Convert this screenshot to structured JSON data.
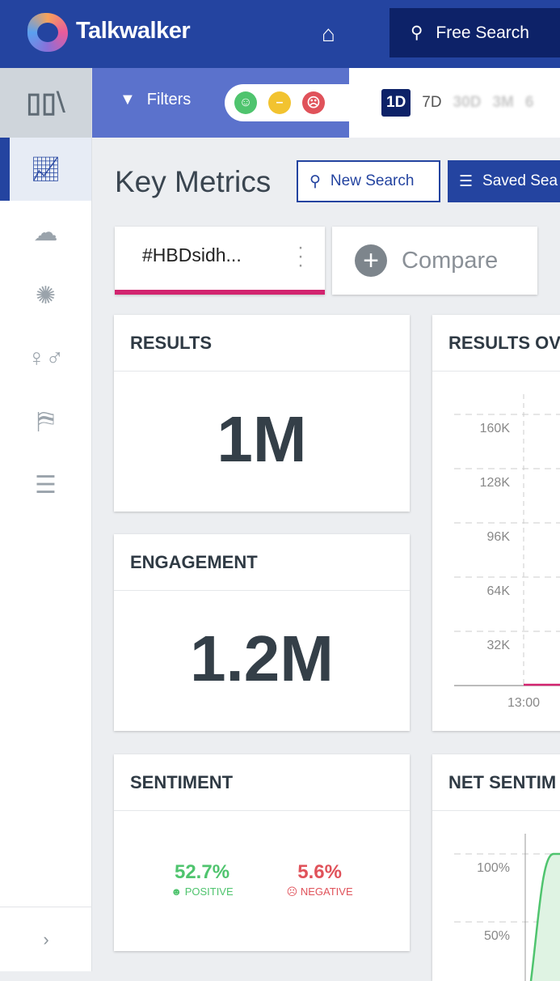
{
  "header": {
    "brand": "Talkwalker",
    "free_search": "Free Search"
  },
  "filterbar": {
    "filters": "Filters",
    "ranges": [
      "1D",
      "7D",
      "30D",
      "3M",
      "6"
    ],
    "selected_range": "1D"
  },
  "page": {
    "title": "Key Metrics",
    "new_search": "New Search",
    "saved_searches": "Saved Sea"
  },
  "tabs": {
    "active": "#HBDsidh...",
    "compare": "Compare"
  },
  "cards": {
    "results": {
      "title": "RESULTS",
      "value": "1M"
    },
    "engagement": {
      "title": "ENGAGEMENT",
      "value": "1.2M"
    },
    "sentiment": {
      "title": "SENTIMENT",
      "positive_value": "52.7%",
      "positive_label": "POSITIVE",
      "negative_value": "5.6%",
      "negative_label": "NEGATIVE"
    },
    "results_over_time": {
      "title": "RESULTS OV"
    },
    "net_sentiment": {
      "title": "NET SENTIM"
    }
  },
  "colors": {
    "header": "#2444a0",
    "accent_pink": "#d2246f",
    "positive": "#4fc46e",
    "negative": "#e0525a"
  },
  "chart_data": [
    {
      "type": "line",
      "title": "RESULTS OV",
      "y_ticks": [
        "160K",
        "128K",
        "96K",
        "64K",
        "32K"
      ],
      "x_ticks": [
        "13:00"
      ],
      "ylim": [
        0,
        170000
      ],
      "grid": true,
      "series": [
        {
          "color": "#d2246f",
          "values": [
            0,
            0
          ]
        }
      ]
    },
    {
      "type": "area",
      "title": "NET SENTIM",
      "y_ticks": [
        "100%",
        "50%"
      ],
      "grid": true,
      "series": [
        {
          "color": "#4fc46e",
          "values": [
            0,
            100,
            100
          ]
        }
      ]
    }
  ]
}
